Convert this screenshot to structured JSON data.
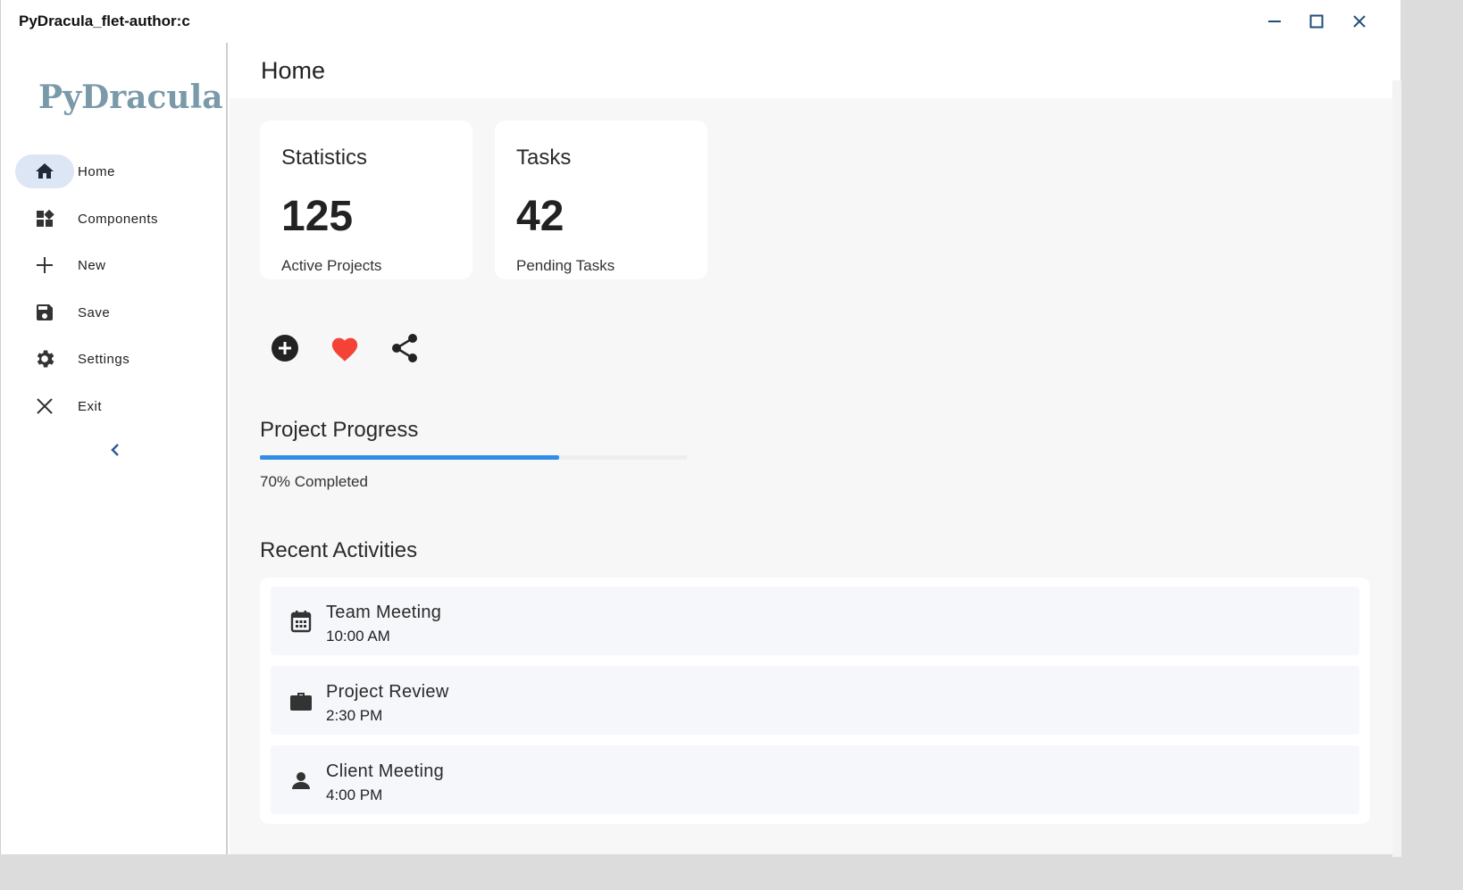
{
  "window": {
    "title": "PyDracula_flet-author:c"
  },
  "sidebar": {
    "logo": "PyDracula",
    "items": [
      {
        "label": "Home",
        "icon": "home-icon",
        "active": true
      },
      {
        "label": "Components",
        "icon": "dashboard-icon"
      },
      {
        "label": "New",
        "icon": "plus-icon"
      },
      {
        "label": "Save",
        "icon": "save-icon"
      },
      {
        "label": "Settings",
        "icon": "gear-icon"
      },
      {
        "label": "Exit",
        "icon": "close-icon"
      }
    ],
    "collapse_icon": "chevron-left-icon"
  },
  "main": {
    "title": "Home",
    "cards": [
      {
        "title": "Statistics",
        "value": "125",
        "sub": "Active Projects"
      },
      {
        "title": "Tasks",
        "value": "42",
        "sub": "Pending Tasks"
      }
    ],
    "actions": [
      {
        "icon": "add-circle-icon"
      },
      {
        "icon": "heart-icon",
        "color": "#f44336"
      },
      {
        "icon": "share-icon"
      }
    ],
    "progress": {
      "title": "Project Progress",
      "value": 0.7,
      "label": "70% Completed",
      "color": "#2f8fe8"
    },
    "activities_title": "Recent Activities",
    "activities": [
      {
        "title": "Team Meeting",
        "time": "10:00 AM",
        "icon": "calendar-icon"
      },
      {
        "title": "Project Review",
        "time": "2:30 PM",
        "icon": "briefcase-icon"
      },
      {
        "title": "Client Meeting",
        "time": "4:00 PM",
        "icon": "person-icon"
      }
    ]
  }
}
